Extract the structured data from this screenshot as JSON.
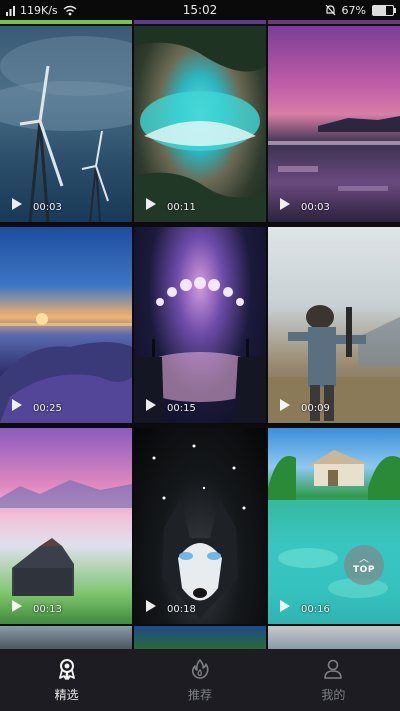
{
  "status_bar": {
    "network_speed": "119K/s",
    "time": "15:02",
    "battery_text": "67%",
    "battery_level": 0.67
  },
  "feed": {
    "tiles": [
      {
        "name": "wind-turbine-storm-video",
        "duration": "00:03"
      },
      {
        "name": "aerial-coast-waves-video",
        "duration": "00:11"
      },
      {
        "name": "pink-sky-ice-shore-video",
        "duration": "00:03"
      },
      {
        "name": "island-sunset-coast-video",
        "duration": "00:25"
      },
      {
        "name": "moon-phases-cliffs-video",
        "duration": "00:15"
      },
      {
        "name": "helmet-soldier-field-video",
        "duration": "00:09"
      },
      {
        "name": "cabin-purple-sky-video",
        "duration": "00:13"
      },
      {
        "name": "husky-face-snow-video",
        "duration": "00:18"
      },
      {
        "name": "tropical-lagoon-hut-video",
        "duration": "00:16"
      }
    ],
    "scroll_top_label": "TOP"
  },
  "bottom_nav": {
    "items": [
      {
        "label": "精选",
        "icon": "award-ribbon-icon",
        "active": true
      },
      {
        "label": "推荐",
        "icon": "flame-icon",
        "active": false
      },
      {
        "label": "我的",
        "icon": "profile-icon",
        "active": false
      }
    ]
  },
  "colors": {
    "nav_background": "#1c1c22",
    "active_label": "#eaeaea",
    "inactive_label": "#7e7e86"
  }
}
